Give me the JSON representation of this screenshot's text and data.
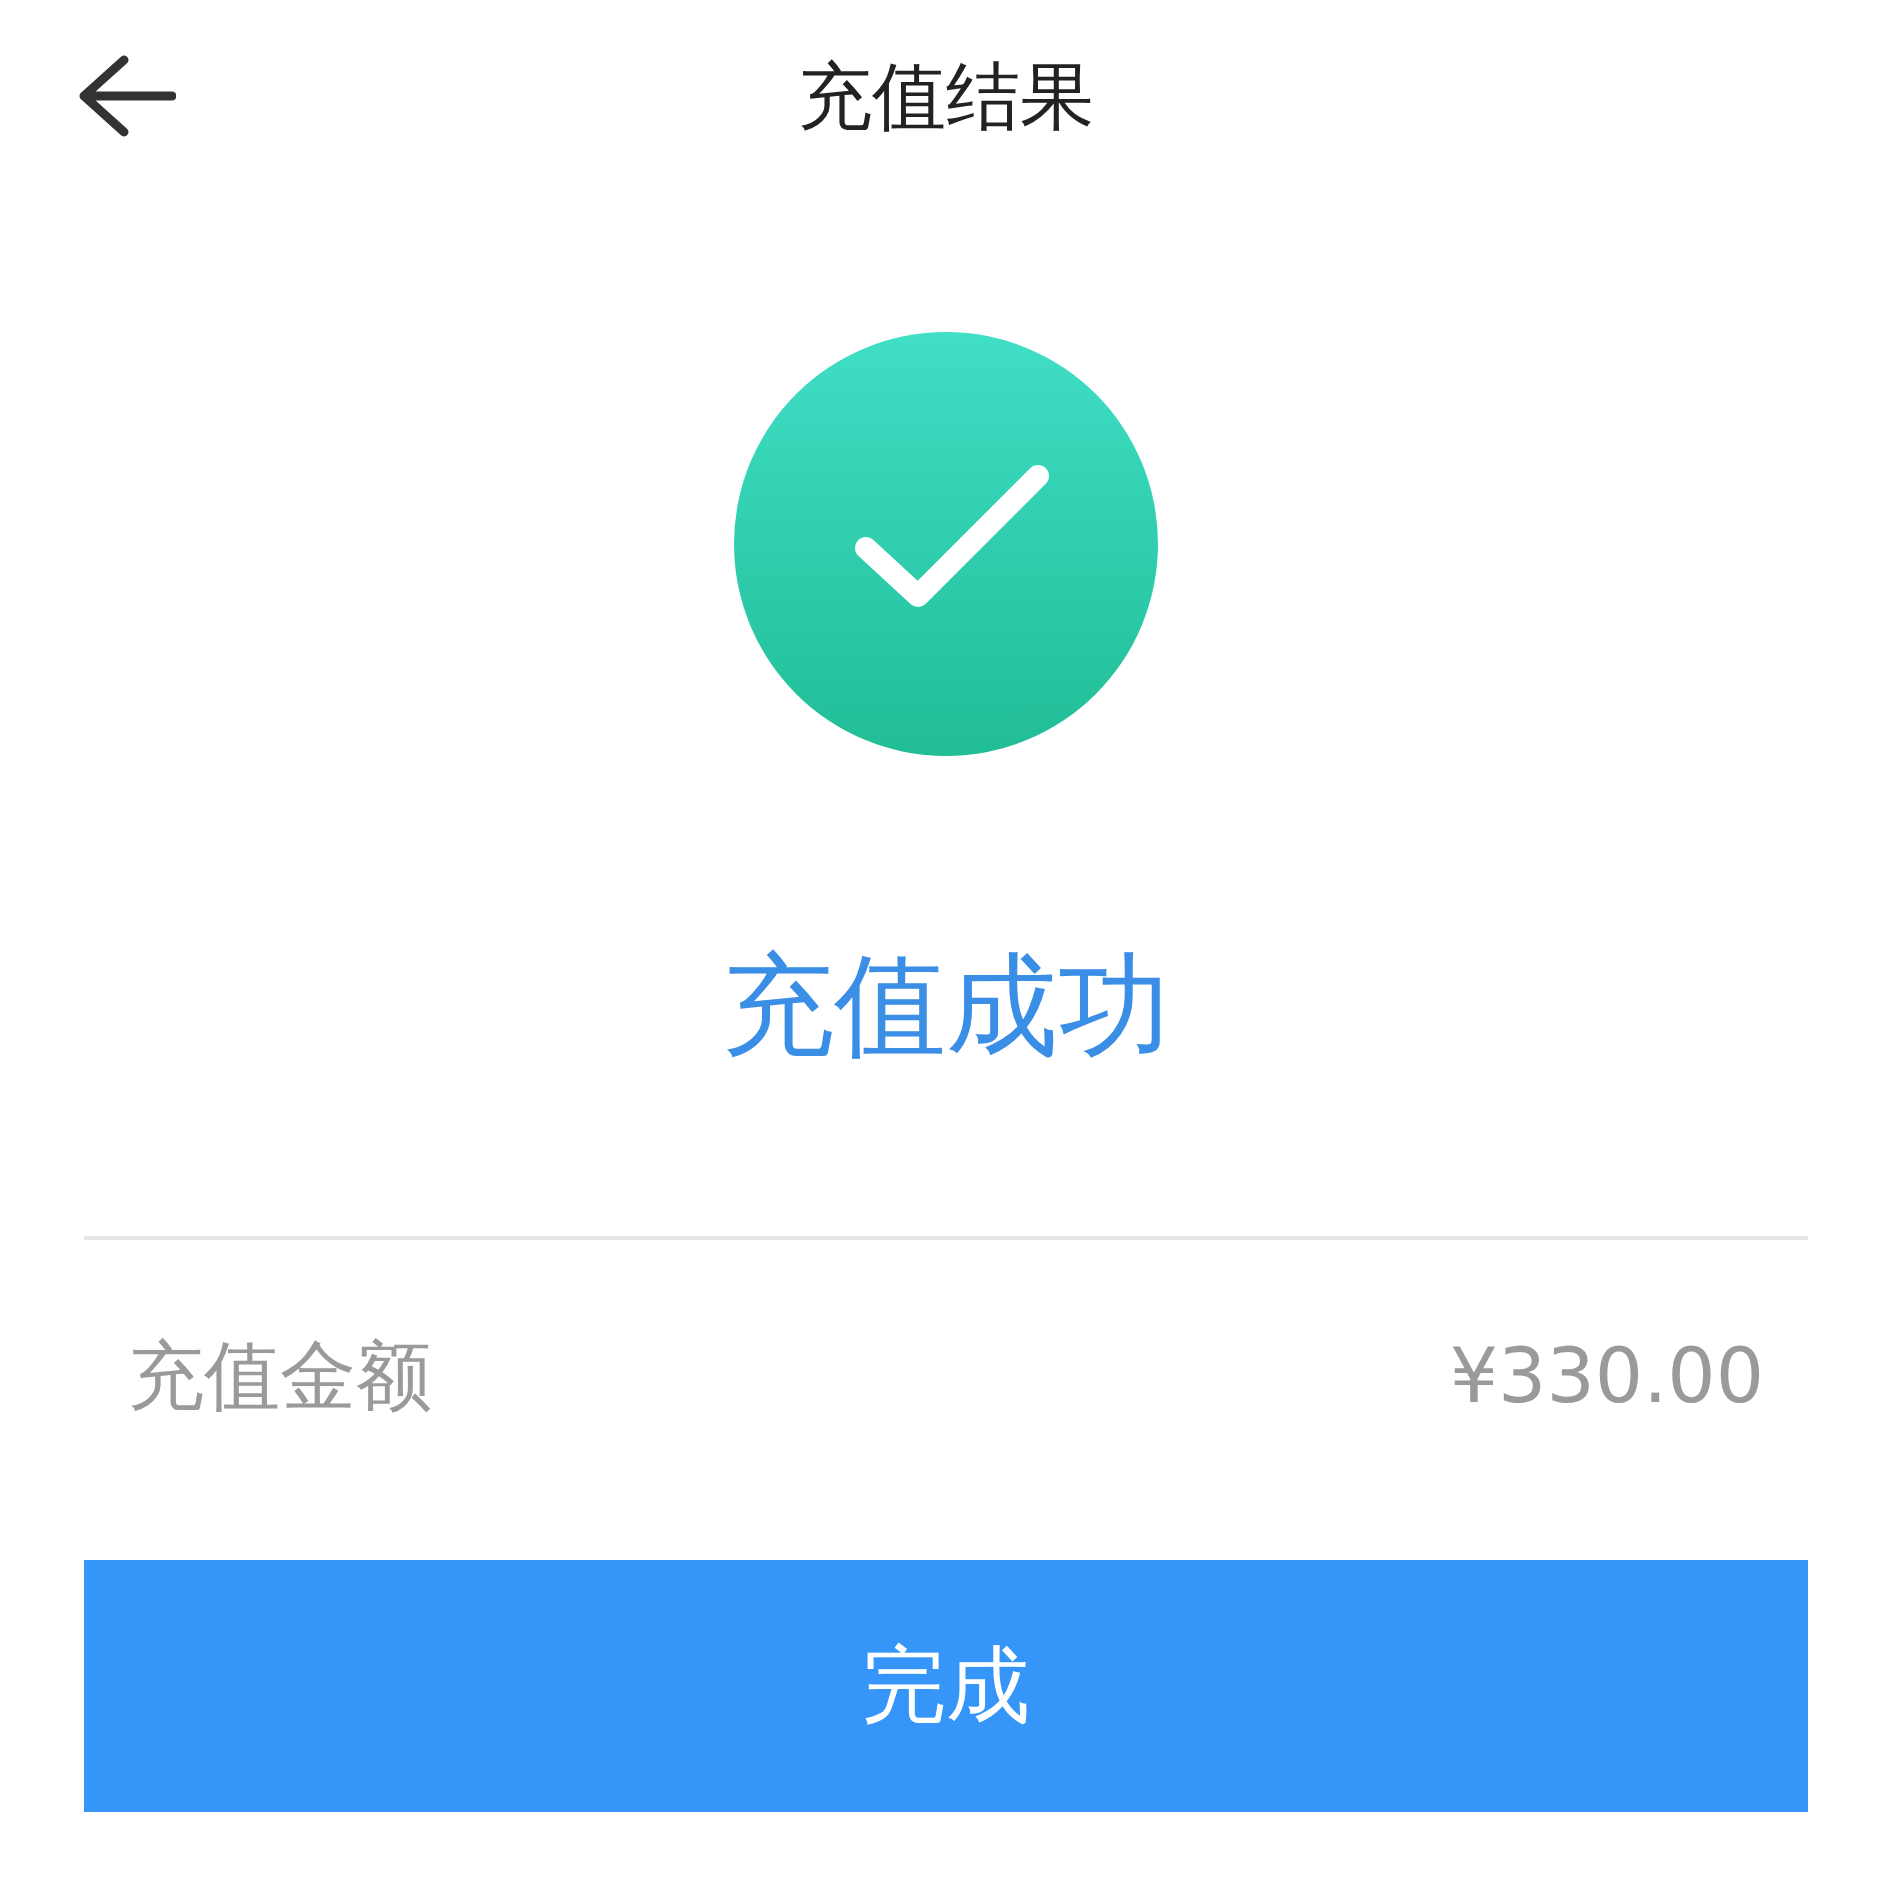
{
  "header": {
    "title": "充值结果"
  },
  "result": {
    "succeeded": true,
    "message": "充值成功"
  },
  "details": [
    {
      "label": "充值金额",
      "value": "¥330.00"
    }
  ],
  "done_button": {
    "label": "完成"
  }
}
